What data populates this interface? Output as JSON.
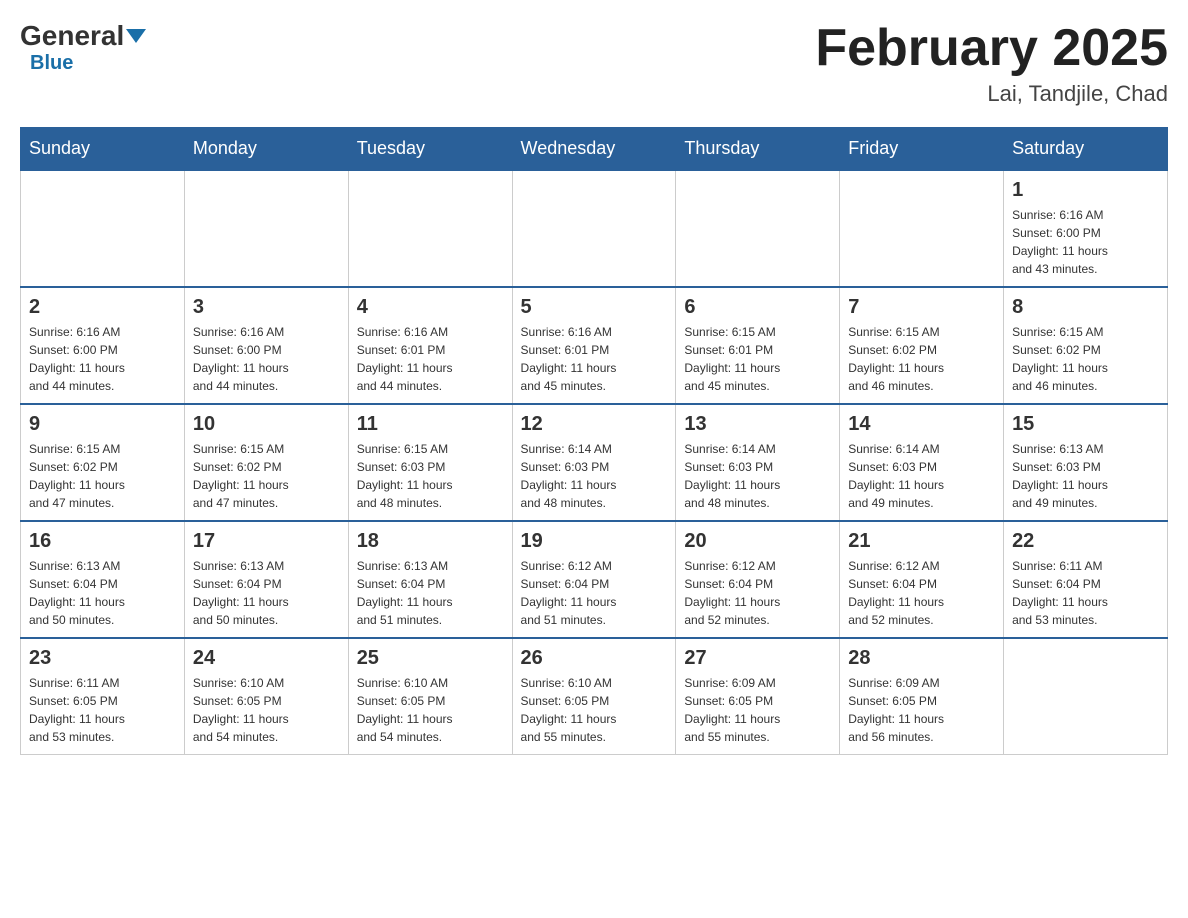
{
  "header": {
    "logo_general": "General",
    "logo_blue": "Blue",
    "month_title": "February 2025",
    "location": "Lai, Tandjile, Chad"
  },
  "days_of_week": [
    "Sunday",
    "Monday",
    "Tuesday",
    "Wednesday",
    "Thursday",
    "Friday",
    "Saturday"
  ],
  "weeks": [
    [
      {
        "day": "",
        "info": ""
      },
      {
        "day": "",
        "info": ""
      },
      {
        "day": "",
        "info": ""
      },
      {
        "day": "",
        "info": ""
      },
      {
        "day": "",
        "info": ""
      },
      {
        "day": "",
        "info": ""
      },
      {
        "day": "1",
        "info": "Sunrise: 6:16 AM\nSunset: 6:00 PM\nDaylight: 11 hours\nand 43 minutes."
      }
    ],
    [
      {
        "day": "2",
        "info": "Sunrise: 6:16 AM\nSunset: 6:00 PM\nDaylight: 11 hours\nand 44 minutes."
      },
      {
        "day": "3",
        "info": "Sunrise: 6:16 AM\nSunset: 6:00 PM\nDaylight: 11 hours\nand 44 minutes."
      },
      {
        "day": "4",
        "info": "Sunrise: 6:16 AM\nSunset: 6:01 PM\nDaylight: 11 hours\nand 44 minutes."
      },
      {
        "day": "5",
        "info": "Sunrise: 6:16 AM\nSunset: 6:01 PM\nDaylight: 11 hours\nand 45 minutes."
      },
      {
        "day": "6",
        "info": "Sunrise: 6:15 AM\nSunset: 6:01 PM\nDaylight: 11 hours\nand 45 minutes."
      },
      {
        "day": "7",
        "info": "Sunrise: 6:15 AM\nSunset: 6:02 PM\nDaylight: 11 hours\nand 46 minutes."
      },
      {
        "day": "8",
        "info": "Sunrise: 6:15 AM\nSunset: 6:02 PM\nDaylight: 11 hours\nand 46 minutes."
      }
    ],
    [
      {
        "day": "9",
        "info": "Sunrise: 6:15 AM\nSunset: 6:02 PM\nDaylight: 11 hours\nand 47 minutes."
      },
      {
        "day": "10",
        "info": "Sunrise: 6:15 AM\nSunset: 6:02 PM\nDaylight: 11 hours\nand 47 minutes."
      },
      {
        "day": "11",
        "info": "Sunrise: 6:15 AM\nSunset: 6:03 PM\nDaylight: 11 hours\nand 48 minutes."
      },
      {
        "day": "12",
        "info": "Sunrise: 6:14 AM\nSunset: 6:03 PM\nDaylight: 11 hours\nand 48 minutes."
      },
      {
        "day": "13",
        "info": "Sunrise: 6:14 AM\nSunset: 6:03 PM\nDaylight: 11 hours\nand 48 minutes."
      },
      {
        "day": "14",
        "info": "Sunrise: 6:14 AM\nSunset: 6:03 PM\nDaylight: 11 hours\nand 49 minutes."
      },
      {
        "day": "15",
        "info": "Sunrise: 6:13 AM\nSunset: 6:03 PM\nDaylight: 11 hours\nand 49 minutes."
      }
    ],
    [
      {
        "day": "16",
        "info": "Sunrise: 6:13 AM\nSunset: 6:04 PM\nDaylight: 11 hours\nand 50 minutes."
      },
      {
        "day": "17",
        "info": "Sunrise: 6:13 AM\nSunset: 6:04 PM\nDaylight: 11 hours\nand 50 minutes."
      },
      {
        "day": "18",
        "info": "Sunrise: 6:13 AM\nSunset: 6:04 PM\nDaylight: 11 hours\nand 51 minutes."
      },
      {
        "day": "19",
        "info": "Sunrise: 6:12 AM\nSunset: 6:04 PM\nDaylight: 11 hours\nand 51 minutes."
      },
      {
        "day": "20",
        "info": "Sunrise: 6:12 AM\nSunset: 6:04 PM\nDaylight: 11 hours\nand 52 minutes."
      },
      {
        "day": "21",
        "info": "Sunrise: 6:12 AM\nSunset: 6:04 PM\nDaylight: 11 hours\nand 52 minutes."
      },
      {
        "day": "22",
        "info": "Sunrise: 6:11 AM\nSunset: 6:04 PM\nDaylight: 11 hours\nand 53 minutes."
      }
    ],
    [
      {
        "day": "23",
        "info": "Sunrise: 6:11 AM\nSunset: 6:05 PM\nDaylight: 11 hours\nand 53 minutes."
      },
      {
        "day": "24",
        "info": "Sunrise: 6:10 AM\nSunset: 6:05 PM\nDaylight: 11 hours\nand 54 minutes."
      },
      {
        "day": "25",
        "info": "Sunrise: 6:10 AM\nSunset: 6:05 PM\nDaylight: 11 hours\nand 54 minutes."
      },
      {
        "day": "26",
        "info": "Sunrise: 6:10 AM\nSunset: 6:05 PM\nDaylight: 11 hours\nand 55 minutes."
      },
      {
        "day": "27",
        "info": "Sunrise: 6:09 AM\nSunset: 6:05 PM\nDaylight: 11 hours\nand 55 minutes."
      },
      {
        "day": "28",
        "info": "Sunrise: 6:09 AM\nSunset: 6:05 PM\nDaylight: 11 hours\nand 56 minutes."
      },
      {
        "day": "",
        "info": ""
      }
    ]
  ]
}
